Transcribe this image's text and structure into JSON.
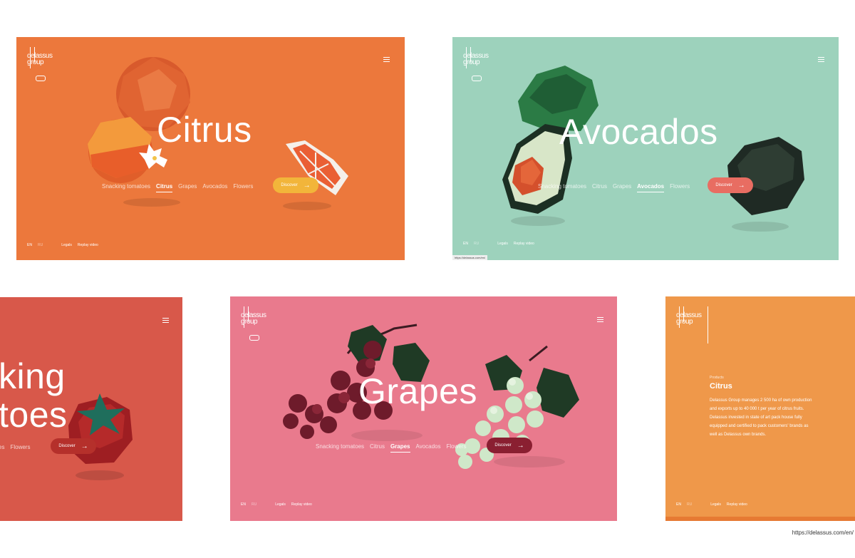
{
  "brand": {
    "logo_line1": "delassus",
    "logo_line2": "group"
  },
  "panels": {
    "citrus": {
      "title": "Citrus",
      "nav": [
        "Snacking tomatoes",
        "Citrus",
        "Grapes",
        "Avocados",
        "Flowers"
      ],
      "active": "Citrus",
      "discover": "Discover",
      "lang_en": "EN",
      "lang_ru": "RU",
      "legals": "Legals",
      "replay": "Replay video",
      "bg": "#EC783C",
      "button_color": "#F2B53A"
    },
    "avocados": {
      "title": "Avocados",
      "nav": [
        "Snacking tomatoes",
        "Citrus",
        "Grapes",
        "Avocados",
        "Flowers"
      ],
      "active": "Avocados",
      "discover": "Discover",
      "lang_en": "EN",
      "lang_ru": "RU",
      "legals": "Legals",
      "replay": "Replay video",
      "status_bar": "https://delassus.com/en/",
      "bg": "#9DD2BC",
      "button_color": "#E86D62"
    },
    "tomatoes": {
      "title_line1": "king",
      "title_line2": "toes",
      "nav_visible": [
        "es",
        "Flowers"
      ],
      "discover": "Discover",
      "bg": "#D8584A",
      "button_color": "#B5302B"
    },
    "grapes": {
      "title": "Grapes",
      "nav": [
        "Snacking tomatoes",
        "Citrus",
        "Grapes",
        "Avocados",
        "Flowers"
      ],
      "active": "Grapes",
      "discover": "Discover",
      "lang_en": "EN",
      "lang_ru": "RU",
      "legals": "Legals",
      "replay": "Replay video",
      "bg": "#E97A8D",
      "button_color": "#8A1F31"
    },
    "product": {
      "eyebrow": "Products",
      "title": "Citrus",
      "description": "Delassus Group manages 2 500 ha of own production and exports up to 40 000 t per year of citrus fruits. Delassus invested in state of art pack house fully equipped and certified to pack customers' brands as well as Delassus own brands.",
      "lang_en": "EN",
      "lang_ru": "RU",
      "legals": "Legals",
      "replay": "Replay video",
      "bg": "#EF984A"
    }
  },
  "url": "https://delassus.com/en/",
  "icons": {
    "menu": "hamburger-icon",
    "arrow": "arrow-right-icon"
  }
}
